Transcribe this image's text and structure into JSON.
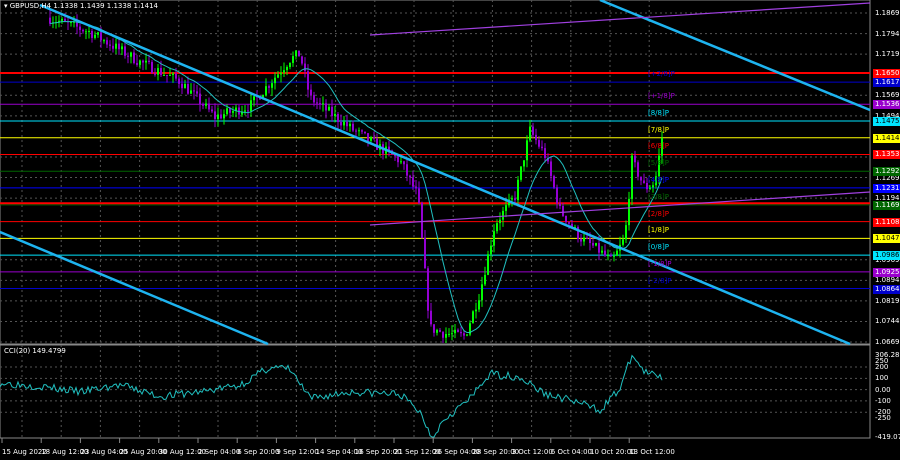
{
  "chart_data": {
    "type": "candlestick",
    "symbol": "GBPUSD,H4",
    "ohlc_header": "1.1338 1.1439 1.1338 1.1414",
    "y_ticks": [
      "1.1869",
      "1.1794",
      "1.1719",
      "1.1569",
      "1.1494",
      "1.1344",
      "1.1269",
      "1.1194",
      "1.0969",
      "1.0894",
      "1.0819",
      "1.0744",
      "1.0669"
    ],
    "ylim": [
      1.0669,
      1.1869
    ],
    "x_ticks": [
      "15 Aug 2022",
      "18 Aug 12:00",
      "23 Aug 04:00",
      "25 Aug 20:00",
      "30 Aug 12:00",
      "2 Sep 04:00",
      "6 Sep 20:00",
      "9 Sep 12:00",
      "14 Sep 04:00",
      "16 Sep 20:00",
      "21 Sep 12:00",
      "26 Sep 04:00",
      "28 Sep 20:00",
      "3 Oct 12:00",
      "6 Oct 04:00",
      "10 Oct 20:00",
      "13 Oct 12:00"
    ],
    "price_path": [
      [
        0,
        1.19
      ],
      [
        50,
        1.185
      ],
      [
        90,
        1.18
      ],
      [
        140,
        1.169
      ],
      [
        180,
        1.162
      ],
      [
        215,
        1.149
      ],
      [
        250,
        1.153
      ],
      [
        290,
        1.17
      ],
      [
        300,
        1.172
      ],
      [
        310,
        1.156
      ],
      [
        350,
        1.145
      ],
      [
        400,
        1.133
      ],
      [
        418,
        1.12
      ],
      [
        430,
        1.072
      ],
      [
        445,
        1.07
      ],
      [
        465,
        1.069
      ],
      [
        480,
        1.085
      ],
      [
        495,
        1.11
      ],
      [
        515,
        1.12
      ],
      [
        530,
        1.144
      ],
      [
        545,
        1.135
      ],
      [
        560,
        1.115
      ],
      [
        580,
        1.105
      ],
      [
        600,
        1.1
      ],
      [
        612,
        1.096
      ],
      [
        625,
        1.105
      ],
      [
        632,
        1.133
      ],
      [
        645,
        1.123
      ],
      [
        655,
        1.125
      ],
      [
        662,
        1.1414
      ]
    ],
    "cci_path": [
      [
        0,
        60
      ],
      [
        40,
        30
      ],
      [
        80,
        -20
      ],
      [
        120,
        40
      ],
      [
        160,
        -60
      ],
      [
        200,
        -20
      ],
      [
        240,
        40
      ],
      [
        270,
        200
      ],
      [
        290,
        180
      ],
      [
        310,
        -80
      ],
      [
        350,
        -20
      ],
      [
        400,
        -40
      ],
      [
        420,
        -200
      ],
      [
        432,
        -419
      ],
      [
        445,
        -250
      ],
      [
        470,
        -80
      ],
      [
        490,
        140
      ],
      [
        520,
        110
      ],
      [
        545,
        -40
      ],
      [
        570,
        -90
      ],
      [
        600,
        -180
      ],
      [
        620,
        10
      ],
      [
        632,
        306
      ],
      [
        645,
        150
      ],
      [
        662,
        110
      ]
    ],
    "cci_ticks": [
      "306.2873",
      "250",
      "200",
      "100",
      "0.00",
      "-100",
      "-200",
      "-250",
      "-419.079"
    ],
    "cci_title": "CCI(20) 149.4799",
    "levels": [
      {
        "price": 1.165,
        "label": "1.1650",
        "color": "#ff0000",
        "line": true,
        "thick": true
      },
      {
        "price": 1.1617,
        "label": "1.1617",
        "color": "#0000cc",
        "line": true
      },
      {
        "price": 1.1536,
        "label": "1.1536",
        "color": "#9900cc",
        "line": true
      },
      {
        "price": 1.1475,
        "label": "1.1475",
        "color": "#00e5ff",
        "line": true
      },
      {
        "price": 1.1414,
        "label": "1.1414",
        "color": "#ffff00",
        "line": true
      },
      {
        "price": 1.1353,
        "label": "1.1353",
        "color": "#ff0000",
        "line": true
      },
      {
        "price": 1.1292,
        "label": "1.1292",
        "color": "#006600",
        "line": true
      },
      {
        "price": 1.1231,
        "label": "1.1231",
        "color": "#0000ff",
        "line": true
      },
      {
        "price": 1.1169,
        "label": "1.1169",
        "color": "#006600",
        "line": true
      },
      {
        "price": 1.1175,
        "label": "",
        "color": "#ff0000",
        "line": true,
        "thick": true
      },
      {
        "price": 1.1108,
        "label": "1.1108",
        "color": "#ff0000",
        "line": true
      },
      {
        "price": 1.1047,
        "label": "1.1047",
        "color": "#ffff00",
        "line": true
      },
      {
        "price": 1.0986,
        "label": "1.0986",
        "color": "#00e5ff",
        "line": true
      },
      {
        "price": 1.0925,
        "label": "1.0925",
        "color": "#9900cc",
        "line": true
      },
      {
        "price": 1.0864,
        "label": "1.0864",
        "color": "#0000cc",
        "line": true
      }
    ],
    "murray_labels": [
      {
        "label": "[+2/8]P",
        "price": 1.1617,
        "color": "#0000cc"
      },
      {
        "label": "[+1/8]P",
        "price": 1.1536,
        "color": "#9900cc"
      },
      {
        "label": "[8/8]P",
        "price": 1.1475,
        "color": "#00e5ff"
      },
      {
        "label": "[7/8]P",
        "price": 1.1414,
        "color": "#ffff00"
      },
      {
        "label": "[6/8]P",
        "price": 1.1353,
        "color": "#ff0000"
      },
      {
        "label": "[5/8]P",
        "price": 1.1292,
        "color": "#006600"
      },
      {
        "label": "[4/8]P",
        "price": 1.1231,
        "color": "#0000ff"
      },
      {
        "label": "[3/8]P",
        "price": 1.1169,
        "color": "#006600"
      },
      {
        "label": "[2/8]P",
        "price": 1.1108,
        "color": "#ff0000"
      },
      {
        "label": "[1/8]P",
        "price": 1.1047,
        "color": "#ffff00"
      },
      {
        "label": "[0/8]P",
        "price": 1.0986,
        "color": "#00e5ff"
      },
      {
        "label": "[-1/8]P",
        "price": 1.0925,
        "color": "#9900cc"
      },
      {
        "label": "[-2/8]P",
        "price": 1.0864,
        "color": "#0000cc"
      }
    ],
    "colors": {
      "bull": "#00ff00",
      "bear": "#9400d3",
      "trend": "#1eb4f0",
      "ma": "#20c0c0",
      "purple": "#a040e0"
    }
  }
}
